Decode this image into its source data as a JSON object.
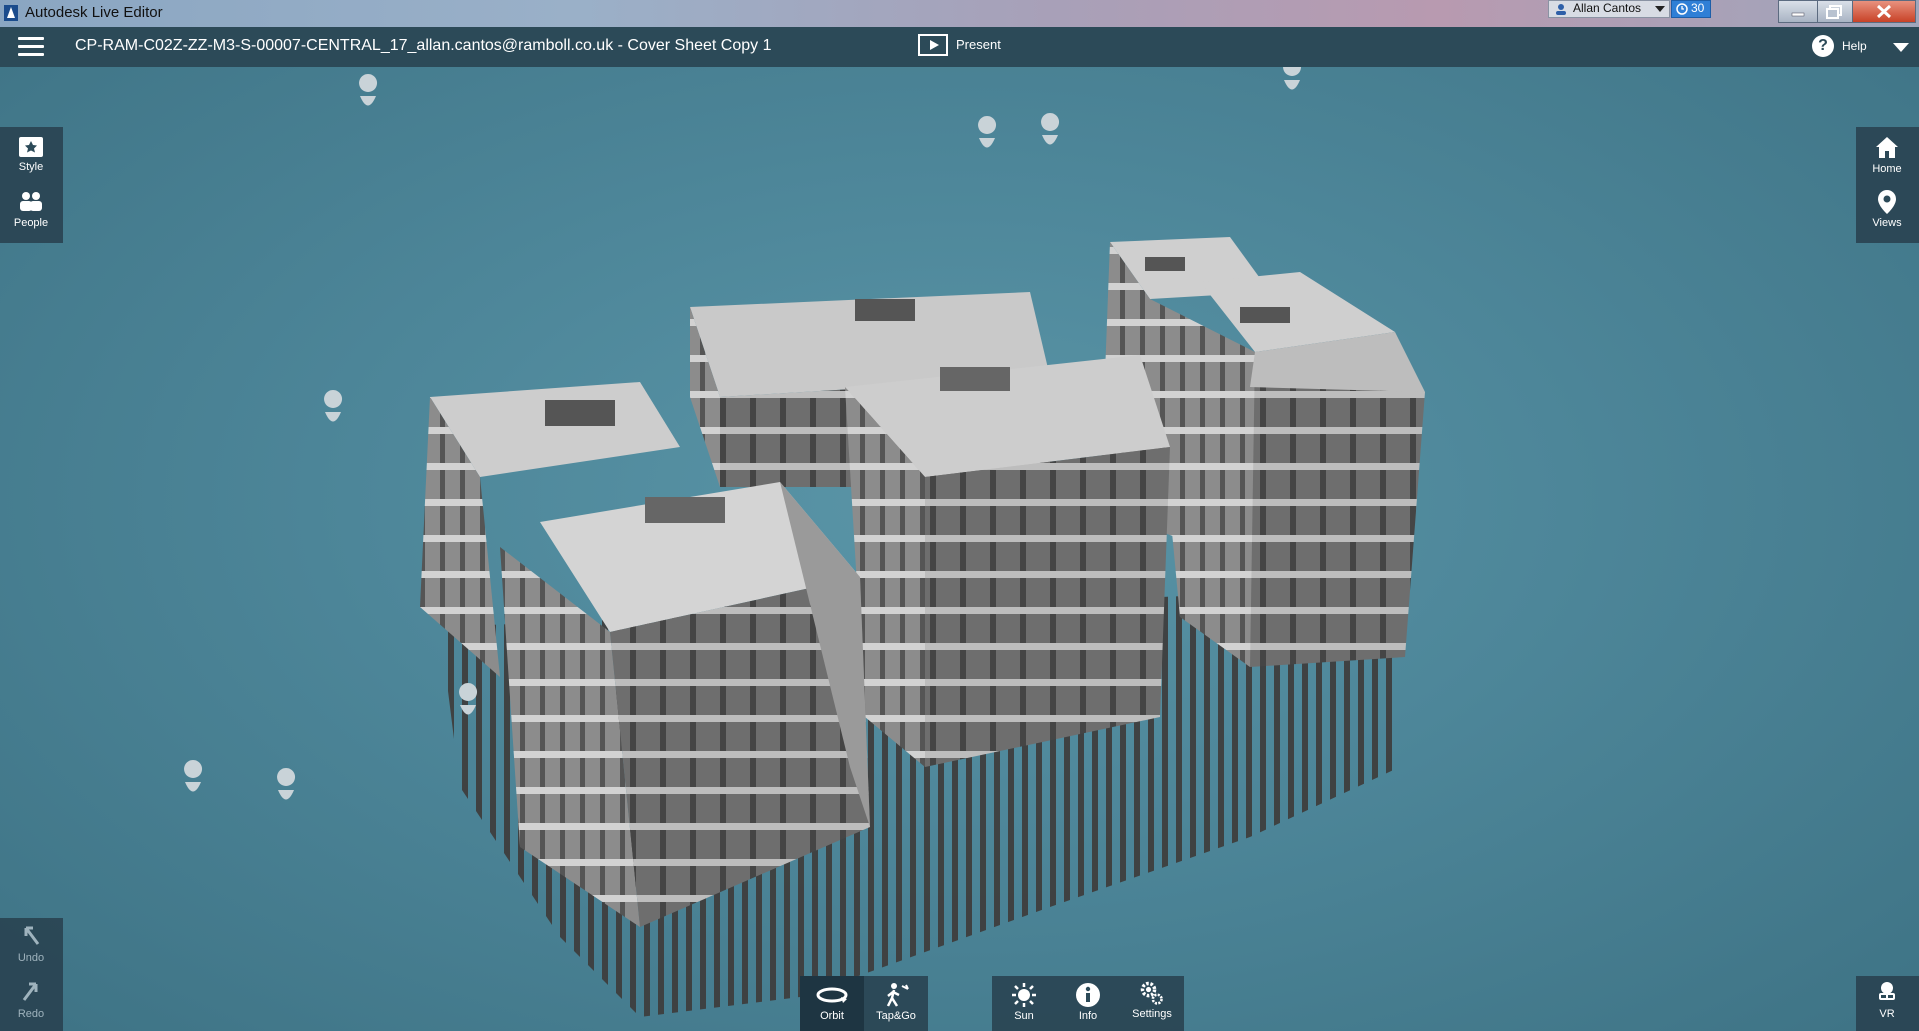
{
  "os_window": {
    "title": "Autodesk Live Editor",
    "user": "Allan Cantos",
    "clock_count": "30"
  },
  "header": {
    "document_title": "CP-RAM-C02Z-ZZ-M3-S-00007-CENTRAL_17_allan.cantos@ramboll.co.uk - Cover Sheet Copy 1",
    "present_label": "Present",
    "help_label": "Help"
  },
  "left_tools": [
    {
      "label": "Style",
      "icon": "style-icon"
    },
    {
      "label": "People",
      "icon": "people-icon"
    }
  ],
  "right_tools": [
    {
      "label": "Home",
      "icon": "home-icon"
    },
    {
      "label": "Views",
      "icon": "views-pin-icon"
    }
  ],
  "history_tools": [
    {
      "label": "Undo",
      "icon": "undo-arrow-icon"
    },
    {
      "label": "Redo",
      "icon": "redo-arrow-icon"
    }
  ],
  "navigation_modes": [
    {
      "label": "Orbit",
      "icon": "orbit-icon",
      "active": true
    },
    {
      "label": "Tap&Go",
      "icon": "walk-icon",
      "active": false
    }
  ],
  "bottom_tools": [
    {
      "label": "Sun",
      "icon": "sun-icon"
    },
    {
      "label": "Info",
      "icon": "info-icon"
    },
    {
      "label": "Settings",
      "icon": "gears-icon"
    }
  ],
  "vr_tool": {
    "label": "VR",
    "icon": "vr-headset-icon"
  },
  "colors": {
    "header_bg": "#2c4a58",
    "viewport_bg": "#4d8699",
    "slab": "#c8c8c8",
    "structure_dark": "#4a4a4a"
  }
}
